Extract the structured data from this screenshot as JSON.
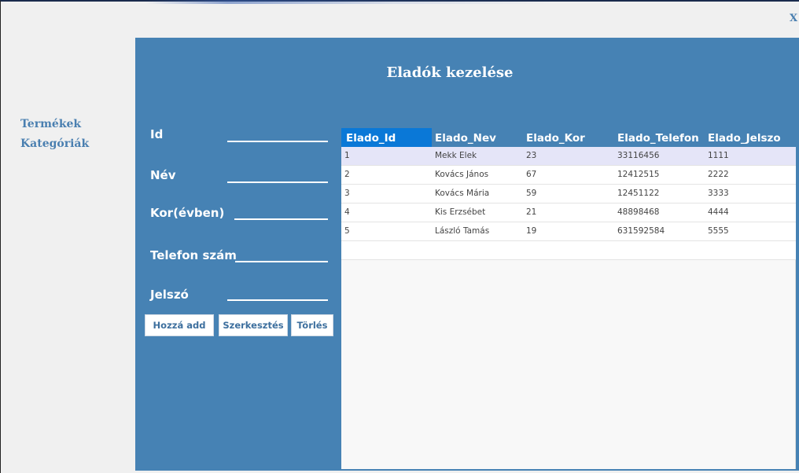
{
  "window": {
    "close_label": "X"
  },
  "nav": {
    "items": [
      {
        "label": "Termékek"
      },
      {
        "label": "Kategóriák"
      }
    ]
  },
  "panel": {
    "title": "Eladók kezelése",
    "form": {
      "id_label": "Id",
      "name_label": "Név",
      "age_label": "Kor(évben)",
      "phone_label": "Telefon szám",
      "password_label": "Jelszó"
    },
    "buttons": {
      "add": "Hozzá add",
      "edit": "Szerkesztés",
      "delete": "Törlés"
    }
  },
  "table": {
    "columns": [
      "Elado_Id",
      "Elado_Nev",
      "Elado_Kor",
      "Elado_Telefon",
      "Elado_Jelszo"
    ],
    "rows": [
      [
        "1",
        "Mekk Elek",
        "23",
        "33116456",
        "1111"
      ],
      [
        "2",
        "Kovács János",
        "67",
        "12412515",
        "2222"
      ],
      [
        "3",
        "Kovács Mária",
        "59",
        "12451122",
        "3333"
      ],
      [
        "4",
        "Kis Erzsébet",
        "21",
        "48898468",
        "4444"
      ],
      [
        "5",
        "László Tamás",
        "19",
        "631592584",
        "5555"
      ]
    ]
  },
  "colors": {
    "panel_bg": "#4682b4",
    "header_active": "#0a78d7",
    "selected_row": "#e5e5f8",
    "nav_link": "#4a7fb0"
  }
}
